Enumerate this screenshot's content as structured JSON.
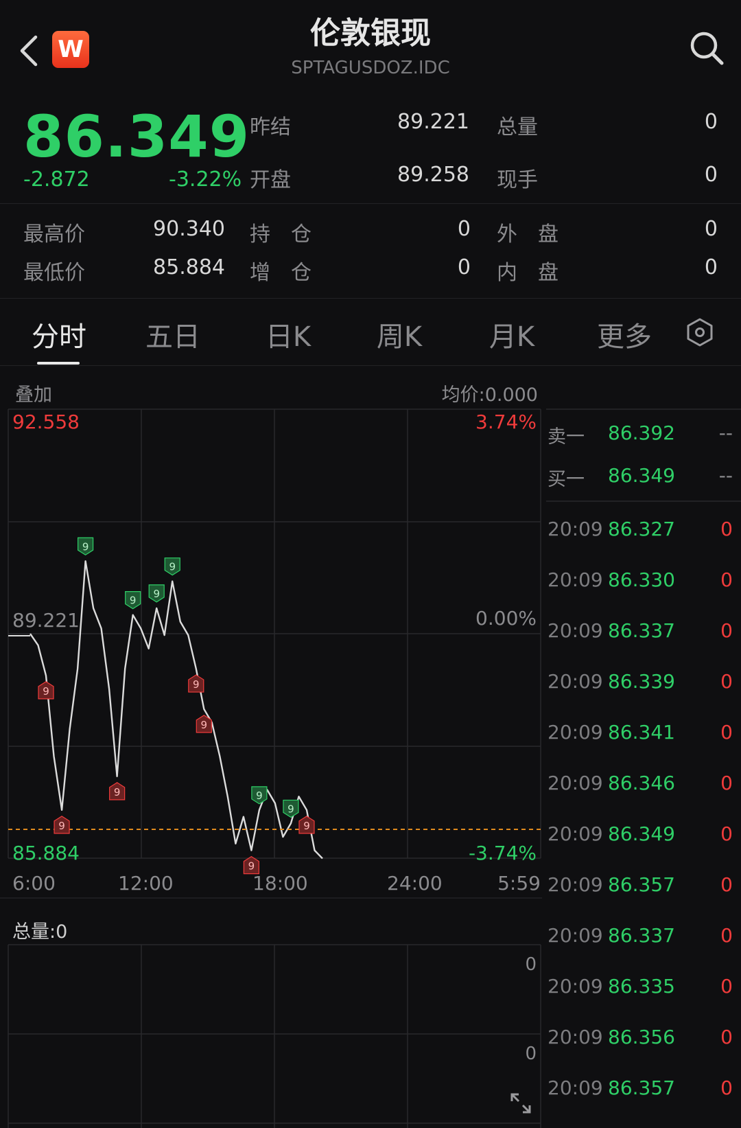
{
  "header": {
    "title": "伦敦银现",
    "symbol": "SPTAGUSDOZ.IDC",
    "logo_text": "W"
  },
  "quote": {
    "price": "86.349",
    "change": "-2.872",
    "change_pct": "-3.22%",
    "colors": {
      "up": "#ef3b3b",
      "down": "#2fcf67"
    }
  },
  "stats": {
    "prev_settle": {
      "label": "昨结",
      "value": "89.221"
    },
    "open": {
      "label": "开盘",
      "value": "89.258"
    },
    "total_volume": {
      "label": "总量",
      "value": "0"
    },
    "current_hand": {
      "label": "现手",
      "value": "0"
    },
    "high": {
      "label": "最高价",
      "value": "90.340"
    },
    "low": {
      "label": "最低价",
      "value": "85.884"
    },
    "open_interest": {
      "label": "持　仓",
      "value": "0"
    },
    "oi_change": {
      "label": "增　仓",
      "value": "0"
    },
    "outer": {
      "label": "外　盘",
      "value": "0"
    },
    "inner": {
      "label": "内　盘",
      "value": "0"
    }
  },
  "tabs": [
    "分时",
    "五日",
    "日K",
    "周K",
    "月K",
    "更多"
  ],
  "chart": {
    "overlay_label": "叠加",
    "avg_price": "均价:0.000",
    "y_top": "92.558",
    "y_mid": "89.221",
    "y_bottom": "85.884",
    "pct_top": "3.74%",
    "pct_mid": "0.00%",
    "pct_bottom": "-3.74%",
    "x_ticks": [
      "6:00",
      "12:00",
      "18:00",
      "24:00",
      "5:59"
    ],
    "volume_label": "总量:0",
    "volume_ticks": [
      "0",
      "0"
    ],
    "marker_label": "9"
  },
  "chart_data": {
    "type": "line",
    "ylim": [
      85.884,
      92.558
    ],
    "reference": 89.221,
    "xlim": [
      "6:00",
      "5:59"
    ],
    "x_ticks": [
      "6:00",
      "12:00",
      "18:00",
      "24:00",
      "5:59"
    ],
    "series": [
      {
        "values": [
          89.22,
          89.05,
          88.6,
          87.4,
          86.6,
          87.8,
          88.7,
          90.3,
          89.6,
          89.3,
          88.4,
          87.1,
          88.7,
          89.5,
          89.3,
          89.0,
          89.6,
          89.2,
          90.0,
          89.4,
          89.2,
          88.7,
          88.1,
          87.9,
          87.4,
          86.8,
          86.1,
          86.5,
          86.0,
          86.6,
          86.9,
          86.7,
          86.2,
          86.4,
          86.8,
          86.6,
          86.0,
          85.88
        ]
      }
    ]
  },
  "orderbook": {
    "ask": {
      "label": "卖一",
      "price": "86.392",
      "vol": "--"
    },
    "bid": {
      "label": "买一",
      "price": "86.349",
      "vol": "--"
    },
    "ticks": [
      {
        "time": "20:09",
        "price": "86.327",
        "vol": "0"
      },
      {
        "time": "20:09",
        "price": "86.330",
        "vol": "0"
      },
      {
        "time": "20:09",
        "price": "86.337",
        "vol": "0"
      },
      {
        "time": "20:09",
        "price": "86.339",
        "vol": "0"
      },
      {
        "time": "20:09",
        "price": "86.341",
        "vol": "0"
      },
      {
        "time": "20:09",
        "price": "86.346",
        "vol": "0"
      },
      {
        "time": "20:09",
        "price": "86.349",
        "vol": "0"
      },
      {
        "time": "20:09",
        "price": "86.357",
        "vol": "0"
      },
      {
        "time": "20:09",
        "price": "86.337",
        "vol": "0"
      },
      {
        "time": "20:09",
        "price": "86.335",
        "vol": "0"
      },
      {
        "time": "20:09",
        "price": "86.356",
        "vol": "0"
      },
      {
        "time": "20:09",
        "price": "86.357",
        "vol": "0"
      }
    ]
  }
}
